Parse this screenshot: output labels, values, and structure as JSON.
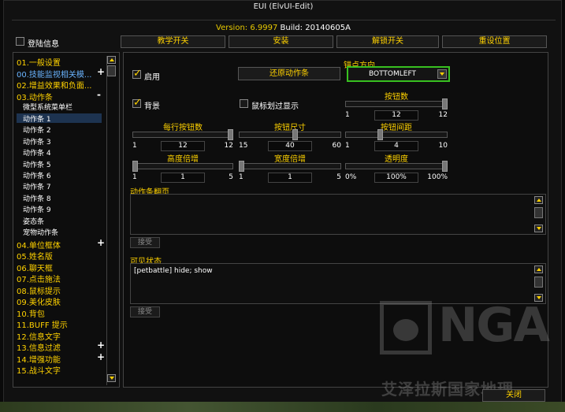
{
  "window": {
    "title": "EUI (ElvUI-Edit)",
    "version_label": "Version:",
    "version": "6.9997",
    "build_label": "Build:",
    "build": "20140605A"
  },
  "top": {
    "login_info": "登陆信息",
    "tabs": [
      "教学开关",
      "安装",
      "解锁开关",
      "重设位置"
    ]
  },
  "sidebar": {
    "items": [
      {
        "label": "01.一般设置"
      },
      {
        "label": "00.技能监视相关模...",
        "expand": "+"
      },
      {
        "label": "02.增益效果和负面..."
      },
      {
        "label": "03.动作条",
        "expand": "-"
      },
      {
        "label": "微型系统菜单栏"
      },
      {
        "label": "动作条 1"
      },
      {
        "label": "动作条 2"
      },
      {
        "label": "动作条 3"
      },
      {
        "label": "动作条 4"
      },
      {
        "label": "动作条 5"
      },
      {
        "label": "动作条 6"
      },
      {
        "label": "动作条 7"
      },
      {
        "label": "动作条 8"
      },
      {
        "label": "动作条 9"
      },
      {
        "label": "姿态条"
      },
      {
        "label": "宠物动作条"
      },
      {
        "label": "04.单位框体",
        "expand": "+"
      },
      {
        "label": "05.姓名版"
      },
      {
        "label": "06.聊天框"
      },
      {
        "label": "07.点击施法"
      },
      {
        "label": "08.鼠标提示"
      },
      {
        "label": "09.美化皮肤"
      },
      {
        "label": "10.背包"
      },
      {
        "label": "11.BUFF 提示"
      },
      {
        "label": "12.信息文字"
      },
      {
        "label": "13.信息过滤",
        "expand": "+"
      },
      {
        "label": "14.增强功能",
        "expand": "+"
      },
      {
        "label": "15.战斗文字"
      }
    ]
  },
  "main": {
    "enable_label": "启用",
    "restore_button": "还原动作条",
    "anchor_label": "锚点方向",
    "anchor_value": "BOTTOMLEFT",
    "backdrop_label": "背景",
    "mouseover_label": "鼠标划过显示",
    "sliders": {
      "buttons": {
        "label": "按钮数",
        "min": "1",
        "max": "12",
        "value": "12",
        "fraction": 1.0
      },
      "per_row": {
        "label": "每行按钮数",
        "min": "1",
        "max": "12",
        "value": "12",
        "fraction": 1.0
      },
      "button_size": {
        "label": "按钮尺寸",
        "min": "15",
        "max": "60",
        "value": "40",
        "fraction": 0.55
      },
      "button_spacing": {
        "label": "按钮间距",
        "min": "1",
        "max": "10",
        "value": "4",
        "fraction": 0.33
      },
      "height_mult": {
        "label": "高度倍增",
        "min": "1",
        "max": "5",
        "value": "1",
        "fraction": 0.0
      },
      "width_mult": {
        "label": "宽度倍增",
        "min": "1",
        "max": "5",
        "value": "1",
        "fraction": 0.0
      },
      "alpha": {
        "label": "透明度",
        "min": "0%",
        "max": "100%",
        "value": "100%",
        "fraction": 1.0
      }
    },
    "paging_label": "动作条翻页",
    "paging_value": "",
    "visibility_label": "可见状态",
    "visibility_value": "[petbattle] hide; show",
    "accept_label": "接受"
  },
  "close_label": "关闭",
  "watermark": {
    "text": "NGA",
    "sub": "艾泽拉斯国家地理"
  },
  "colors": {
    "accent": "#ffd200",
    "dropdown_border": "#38c020",
    "selection": "#1d3350"
  }
}
